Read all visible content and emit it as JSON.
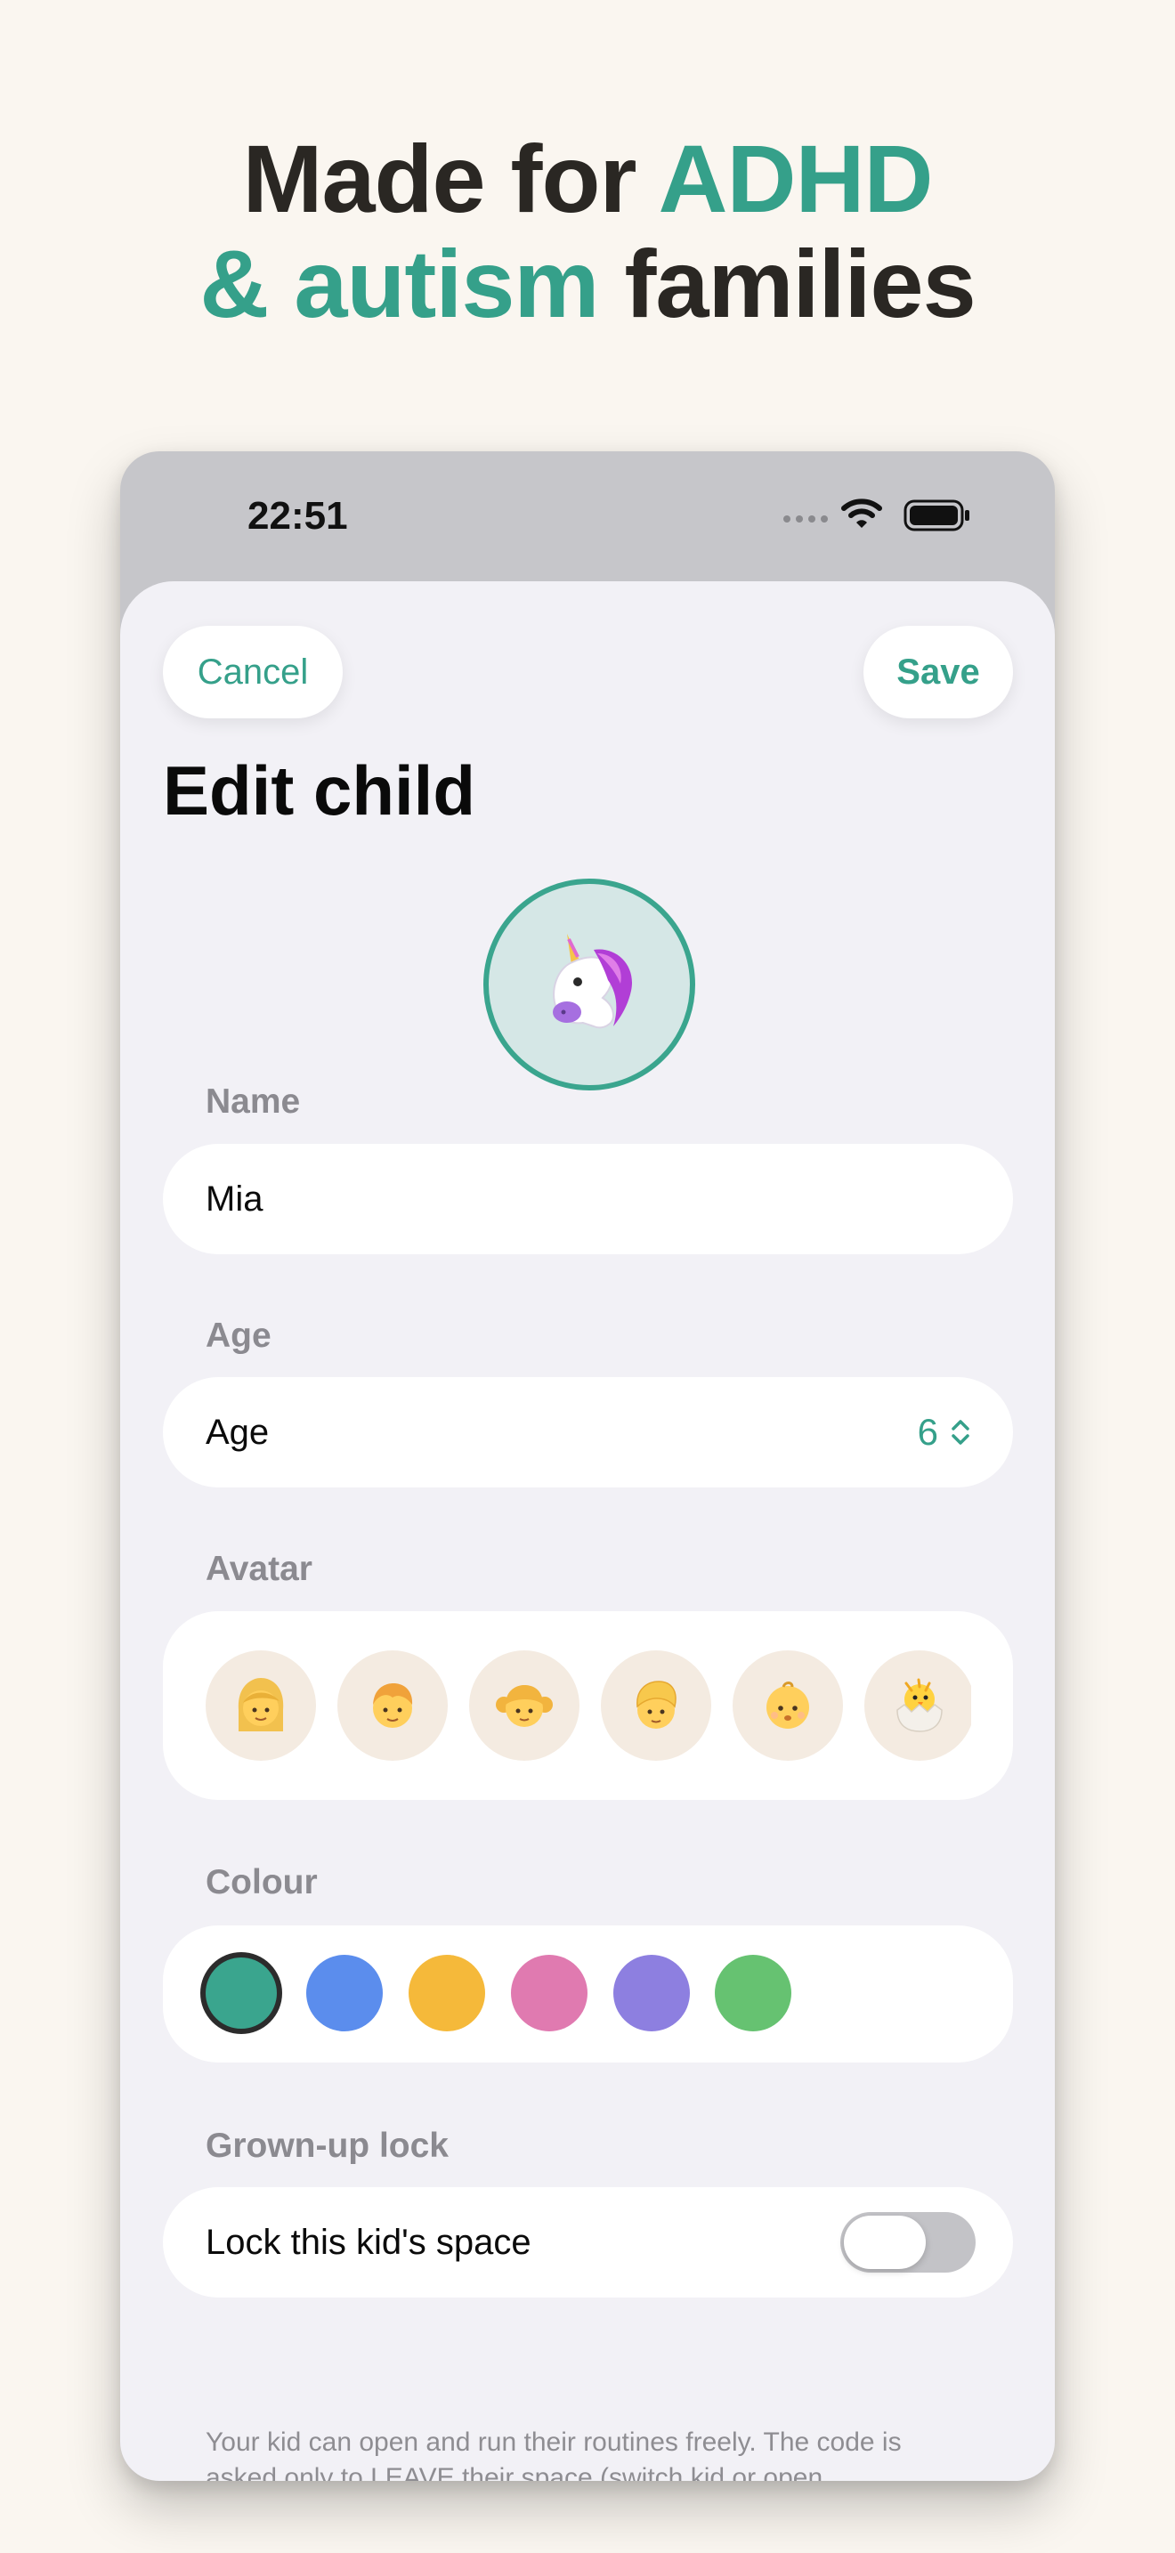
{
  "headline": {
    "line1_plain": "Made for ",
    "line1_accent": "ADHD",
    "line2_accent": "& autism",
    "line2_plain": " families"
  },
  "status_bar": {
    "time": "22:51"
  },
  "nav": {
    "cancel_label": "Cancel",
    "save_label": "Save"
  },
  "page_title": "Edit child",
  "selected_avatar": "🦄",
  "name_section": {
    "label": "Name",
    "value": "Mia"
  },
  "age_section": {
    "label": "Age",
    "field_label": "Age",
    "value": "6"
  },
  "avatar_section": {
    "label": "Avatar",
    "options": [
      "👩",
      "👦",
      "👧",
      "👱",
      "👶",
      "🐣"
    ]
  },
  "colour_section": {
    "label": "Colour",
    "swatches": [
      "#3aa58e",
      "#5b8ded",
      "#f5b93a",
      "#e07ab0",
      "#8d7fe0",
      "#66c271"
    ],
    "selected_index": 0
  },
  "lock_section": {
    "label": "Grown-up lock",
    "toggle_label": "Lock this kid's space",
    "enabled": false,
    "footnote_line1": "Your kid can open and run their routines freely. The code is",
    "footnote_line2": "asked only to LEAVE their space (switch kid or open"
  },
  "colors": {
    "accent": "#35a08a",
    "page_bg": "#faf6f0",
    "sheet_bg": "#f2f1f6"
  }
}
